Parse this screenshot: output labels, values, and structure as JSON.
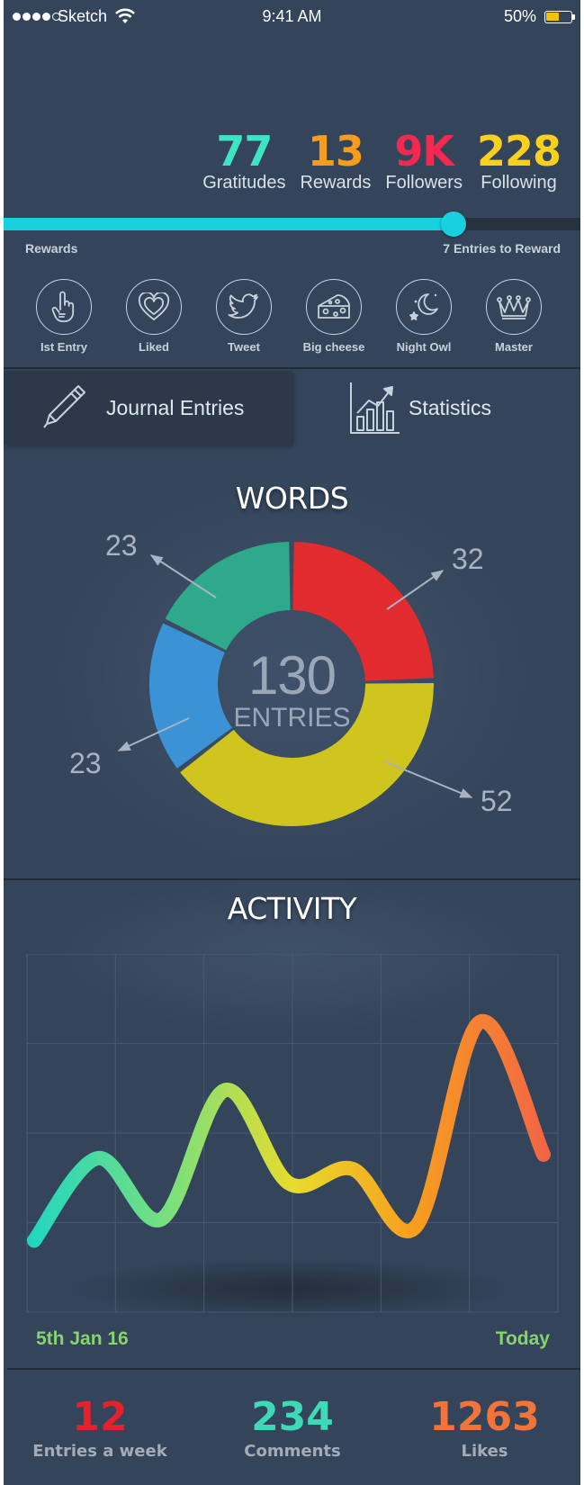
{
  "status_bar": {
    "carrier": "Sketch",
    "time": "9:41 AM",
    "battery_percent": "50%",
    "battery_level": 0.5,
    "signal_bars": 4,
    "signal_total": 5
  },
  "stats": [
    {
      "value": "77",
      "label": "Gratitudes",
      "color": "#3ee5c4"
    },
    {
      "value": "13",
      "label": "Rewards",
      "color": "#f89c1c"
    },
    {
      "value": "9K",
      "label": "Followers",
      "color": "#f5284f"
    },
    {
      "value": "228",
      "label": "Following",
      "color": "#f9d11d"
    }
  ],
  "progress": {
    "left_label": "Rewards",
    "right_label": "7 Entries to Reward",
    "fraction": 0.78,
    "color": "#19d0e0"
  },
  "badges": [
    {
      "label": "Ist Entry",
      "icon": "hand-one-icon"
    },
    {
      "label": "Liked",
      "icon": "heart-icon"
    },
    {
      "label": "Tweet",
      "icon": "bird-icon"
    },
    {
      "label": "Big cheese",
      "icon": "cheese-icon"
    },
    {
      "label": "Night Owl",
      "icon": "moon-stars-icon"
    },
    {
      "label": "Master",
      "icon": "crown-icon"
    }
  ],
  "tabs": {
    "journal": {
      "label": "Journal Entries",
      "icon": "pen-icon"
    },
    "statistics": {
      "label": "Statistics",
      "icon": "bar-chart-icon"
    }
  },
  "words": {
    "title": "WORDS",
    "center_value": "130",
    "center_label": "ENTRIES",
    "chart_data": {
      "type": "pie",
      "values": [
        32,
        52,
        23,
        23
      ],
      "colors": [
        "#e12b2f",
        "#d0c41e",
        "#3b92d4",
        "#2ea98b"
      ]
    }
  },
  "activity": {
    "title": "ACTIVITY",
    "start_label": "5th Jan 16",
    "end_label": "Today",
    "chart_data": {
      "type": "line",
      "values": [
        20,
        43,
        26,
        62,
        36,
        40,
        24,
        81,
        44
      ],
      "ylim": [
        0,
        100
      ],
      "gradient": [
        "#1fd6c2",
        "#7de07a",
        "#e8dc2c",
        "#f7a01e",
        "#f26047"
      ]
    }
  },
  "bottom_stats": [
    {
      "value": "12",
      "label": "Entries a week",
      "color": "#e5222c"
    },
    {
      "value": "234",
      "label": "Comments",
      "color": "#3ed9b6"
    },
    {
      "value": "1263",
      "label": "Likes",
      "color": "#f2743a"
    }
  ]
}
